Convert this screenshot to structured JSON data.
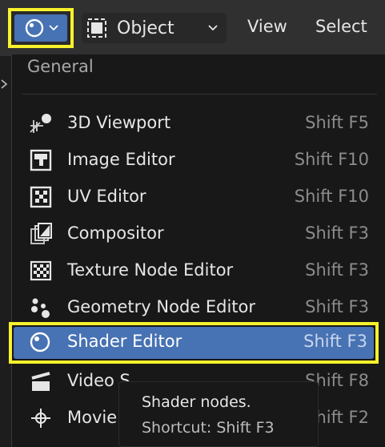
{
  "header": {
    "mode_label": "Object",
    "menu": [
      "View",
      "Select"
    ],
    "editor_type_icon": "shader-editor-icon"
  },
  "dropdown": {
    "section": "General",
    "items": [
      {
        "label": "3D Viewport",
        "shortcut": "Shift F5",
        "icon": "3d-viewport-icon"
      },
      {
        "label": "Image Editor",
        "shortcut": "Shift F10",
        "icon": "image-editor-icon"
      },
      {
        "label": "UV Editor",
        "shortcut": "Shift F10",
        "icon": "uv-editor-icon"
      },
      {
        "label": "Compositor",
        "shortcut": "Shift F3",
        "icon": "compositor-icon"
      },
      {
        "label": "Texture Node Editor",
        "shortcut": "Shift F3",
        "icon": "texture-node-editor-icon"
      },
      {
        "label": "Geometry Node Editor",
        "shortcut": "Shift F3",
        "icon": "geometry-node-editor-icon"
      },
      {
        "label": "Shader Editor",
        "shortcut": "Shift F3",
        "icon": "shader-editor-icon",
        "active": true
      },
      {
        "label": "Video S",
        "shortcut": "Shift F8",
        "icon": "video-sequencer-icon"
      },
      {
        "label": "Movie",
        "shortcut": "Shift F2",
        "icon": "movie-clip-editor-icon"
      }
    ]
  },
  "tooltip": {
    "title": "Shader nodes.",
    "shortcut_text": "Shortcut: Shift F3"
  },
  "colors": {
    "accent": "#4772b3",
    "highlight_border": "#f7f22c",
    "menu_bg": "#181818",
    "header_bg": "#303030"
  }
}
